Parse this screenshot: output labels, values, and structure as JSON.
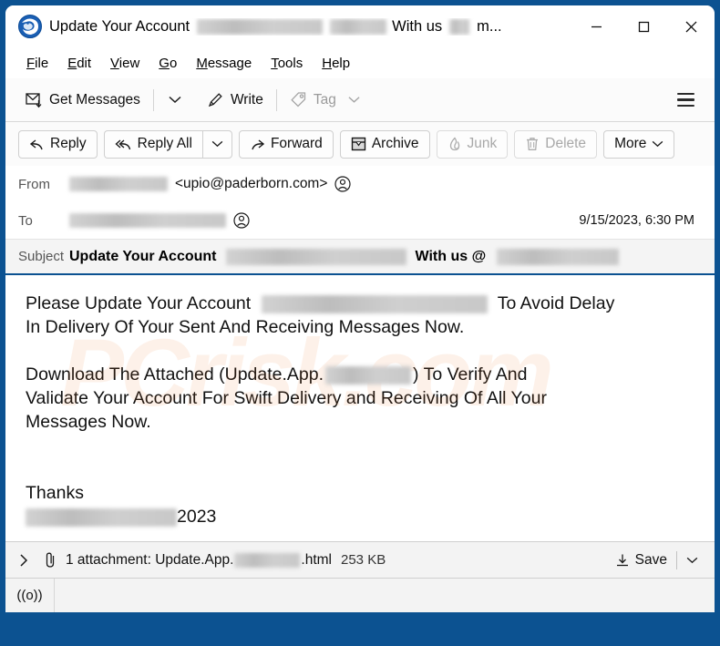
{
  "window": {
    "border_color": "#0c5291",
    "title_prefix": "Update Your Account",
    "title_middle": "With us",
    "title_truncated": "m...",
    "logo_icon": "thunderbird-logo-icon",
    "controls": {
      "minimize": "minimize-icon",
      "maximize": "maximize-icon",
      "close": "close-icon"
    }
  },
  "menubar": {
    "items": [
      {
        "label": "File",
        "accel": "F"
      },
      {
        "label": "Edit",
        "accel": "E"
      },
      {
        "label": "View",
        "accel": "V"
      },
      {
        "label": "Go",
        "accel": "G"
      },
      {
        "label": "Message",
        "accel": "M"
      },
      {
        "label": "Tools",
        "accel": "T"
      },
      {
        "label": "Help",
        "accel": "H"
      }
    ]
  },
  "main_toolbar": {
    "get_messages": "Get Messages",
    "write": "Write",
    "tag": "Tag",
    "menu_icon": "hamburger-menu-icon"
  },
  "message_toolbar": {
    "reply": "Reply",
    "reply_all": "Reply All",
    "forward": "Forward",
    "archive": "Archive",
    "junk": "Junk",
    "delete": "Delete",
    "more": "More"
  },
  "headers": {
    "from_label": "From",
    "from_address": "<upio@paderborn.com>",
    "to_label": "To",
    "date": "9/15/2023, 6:30 PM",
    "subject_label": "Subject",
    "subject_part1": "Update Your Account",
    "subject_part2": "With us @"
  },
  "body": {
    "p1_a": "Please Update Your Account",
    "p1_b": "To Avoid Delay",
    "p1_c": "In Delivery Of Your Sent And Receiving Messages Now.",
    "p2_a": "Download The Attached (Update.App.",
    "p2_b": ") To Verify And",
    "p2_c": "Validate Your Account For Swift  Delivery and Receiving Of All Your",
    "p2_d": "Messages Now.",
    "sign_thanks": "Thanks",
    "sign_year": "2023",
    "watermark_text": "PCrisk.com"
  },
  "attachment": {
    "expand_icon": "chevron-right-icon",
    "paperclip_icon": "paperclip-icon",
    "label_prefix": "1 attachment: Update.App.",
    "label_suffix": ".html",
    "size": "253 KB",
    "save_label": "Save",
    "save_icon": "download-icon"
  },
  "statusbar": {
    "connection_icon": "broadcast-icon",
    "connection_glyph": "((o))"
  }
}
